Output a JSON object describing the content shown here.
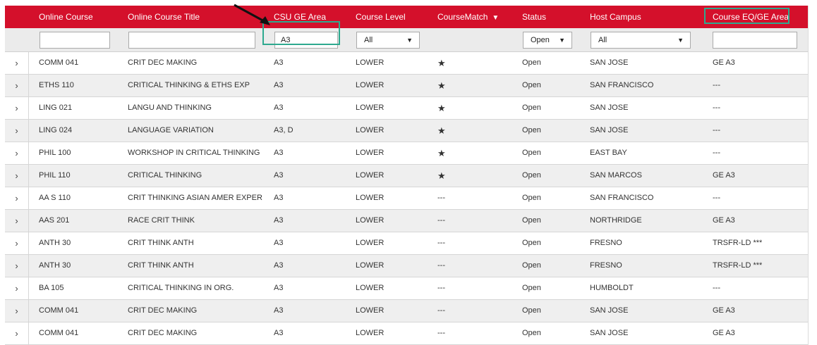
{
  "header": {
    "columns": [
      {
        "key": "course",
        "label": "Online Course"
      },
      {
        "key": "title",
        "label": "Online Course Title"
      },
      {
        "key": "ge",
        "label": "CSU GE Area"
      },
      {
        "key": "level",
        "label": "Course Level"
      },
      {
        "key": "match",
        "label": "CourseMatch"
      },
      {
        "key": "status",
        "label": "Status"
      },
      {
        "key": "host",
        "label": "Host Campus"
      },
      {
        "key": "eq",
        "label": "Course EQ/GE Area"
      }
    ],
    "sort_indicator": "▼"
  },
  "filters": {
    "course": "",
    "title": "",
    "ge": "A3",
    "level": "All",
    "status": "Open",
    "host": "All",
    "eq": "",
    "dropdown_arrow": "▼"
  },
  "icons": {
    "expand": "›",
    "star": "★"
  },
  "rows": [
    {
      "course": "COMM 041",
      "title": "CRIT DEC MAKING",
      "ge": "A3",
      "level": "LOWER",
      "match": "★",
      "status": "Open",
      "host": "SAN JOSE",
      "eq": "GE A3"
    },
    {
      "course": "ETHS 110",
      "title": "CRITICAL THINKING & ETHS EXP",
      "ge": "A3",
      "level": "LOWER",
      "match": "★",
      "status": "Open",
      "host": "SAN FRANCISCO",
      "eq": "---"
    },
    {
      "course": "LING 021",
      "title": "LANGU AND THINKING",
      "ge": "A3",
      "level": "LOWER",
      "match": "★",
      "status": "Open",
      "host": "SAN JOSE",
      "eq": "---"
    },
    {
      "course": "LING 024",
      "title": "LANGUAGE VARIATION",
      "ge": "A3, D",
      "level": "LOWER",
      "match": "★",
      "status": "Open",
      "host": "SAN JOSE",
      "eq": "---"
    },
    {
      "course": "PHIL 100",
      "title": "WORKSHOP IN CRITICAL THINKING",
      "ge": "A3",
      "level": "LOWER",
      "match": "★",
      "status": "Open",
      "host": "EAST BAY",
      "eq": "---"
    },
    {
      "course": "PHIL 110",
      "title": "CRITICAL THINKING",
      "ge": "A3",
      "level": "LOWER",
      "match": "★",
      "status": "Open",
      "host": "SAN MARCOS",
      "eq": "GE A3"
    },
    {
      "course": "AA S 110",
      "title": "CRIT THINKING ASIAN AMER EXPER",
      "ge": "A3",
      "level": "LOWER",
      "match": "---",
      "status": "Open",
      "host": "SAN FRANCISCO",
      "eq": "---"
    },
    {
      "course": "AAS 201",
      "title": "RACE CRIT THINK",
      "ge": "A3",
      "level": "LOWER",
      "match": "---",
      "status": "Open",
      "host": "NORTHRIDGE",
      "eq": "GE A3"
    },
    {
      "course": "ANTH 30",
      "title": "CRIT THINK ANTH",
      "ge": "A3",
      "level": "LOWER",
      "match": "---",
      "status": "Open",
      "host": "FRESNO",
      "eq": "TRSFR-LD ***"
    },
    {
      "course": "ANTH 30",
      "title": "CRIT THINK ANTH",
      "ge": "A3",
      "level": "LOWER",
      "match": "---",
      "status": "Open",
      "host": "FRESNO",
      "eq": "TRSFR-LD ***"
    },
    {
      "course": "BA 105",
      "title": "CRITICAL THINKING IN ORG.",
      "ge": "A3",
      "level": "LOWER",
      "match": "---",
      "status": "Open",
      "host": "HUMBOLDT",
      "eq": "---"
    },
    {
      "course": "COMM 041",
      "title": "CRIT DEC MAKING",
      "ge": "A3",
      "level": "LOWER",
      "match": "---",
      "status": "Open",
      "host": "SAN JOSE",
      "eq": "GE A3"
    },
    {
      "course": "COMM 041",
      "title": "CRIT DEC MAKING",
      "ge": "A3",
      "level": "LOWER",
      "match": "---",
      "status": "Open",
      "host": "SAN JOSE",
      "eq": "GE A3"
    }
  ],
  "colors": {
    "header_bg": "#d4102b",
    "highlight": "#2ea98f",
    "row_alt": "#efefef"
  }
}
